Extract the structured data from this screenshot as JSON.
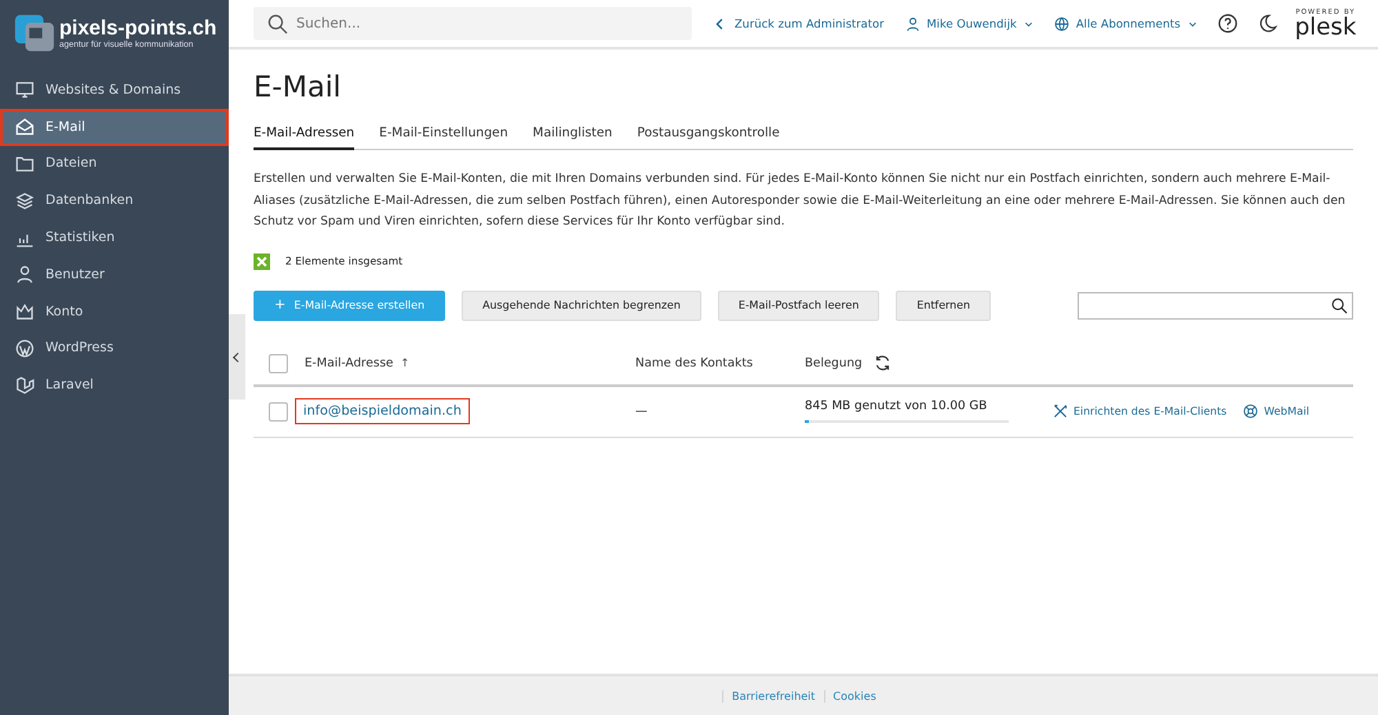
{
  "brand": {
    "name": "pixels-points.ch",
    "tagline": "agentur für visuelle kommunikation"
  },
  "sidebar": {
    "items": [
      {
        "label": "Websites & Domains",
        "selected": false,
        "highlighted": false
      },
      {
        "label": "E-Mail",
        "selected": true,
        "highlighted": true
      },
      {
        "label": "Dateien",
        "selected": false,
        "highlighted": false
      },
      {
        "label": "Datenbanken",
        "selected": false,
        "highlighted": false
      },
      {
        "label": "Statistiken",
        "selected": false,
        "highlighted": false
      },
      {
        "label": "Benutzer",
        "selected": false,
        "highlighted": false
      },
      {
        "label": "Konto",
        "selected": false,
        "highlighted": false
      },
      {
        "label": "WordPress",
        "selected": false,
        "highlighted": false
      },
      {
        "label": "Laravel",
        "selected": false,
        "highlighted": false
      }
    ]
  },
  "header": {
    "search": {
      "placeholder": "Suchen..."
    },
    "back_link": "Zurück zum Administrator",
    "user": "Mike Ouwendijk",
    "subscriptions": "Alle Abonnements",
    "powered_by": "POWERED BY",
    "plesk": "plesk"
  },
  "page": {
    "title": "E-Mail",
    "tabs": [
      {
        "label": "E-Mail-Adressen",
        "selected": true
      },
      {
        "label": "E-Mail-Einstellungen",
        "selected": false
      },
      {
        "label": "Mailinglisten",
        "selected": false
      },
      {
        "label": "Postausgangskontrolle",
        "selected": false
      }
    ],
    "description": "Erstellen und verwalten Sie E-Mail-Konten, die mit Ihren Domains verbunden sind. Für jedes E-Mail-Konto können Sie nicht nur ein Postfach einrichten, sondern auch mehrere E-Mail-Aliases (zusätzliche E-Mail-Adressen, die zum selben Postfach führen), einen Autoresponder sowie die E-Mail-Weiterleitung an eine oder mehrere E-Mail-Adressen. Sie können auch den Schutz vor Spam und Viren einrichten, sofern diese Services für Ihr Konto verfügbar sind.",
    "total": "2 Elemente insgesamt",
    "buttons": [
      {
        "label": "E-Mail-Adresse erstellen",
        "kind": "primary",
        "icon": "+"
      },
      {
        "label": "Ausgehende Nachrichten begrenzen",
        "kind": "secondary"
      },
      {
        "label": "E-Mail-Postfach leeren",
        "kind": "secondary"
      },
      {
        "label": "Entfernen",
        "kind": "secondary"
      }
    ],
    "table": {
      "select_all_checked": false,
      "columns": [
        "E-Mail-Adresse",
        "Name des Kontakts",
        "Belegung"
      ],
      "sort_mark": "↑",
      "rows": [
        {
          "checked": false,
          "address": "info@beispieldomain.ch",
          "highlighted": true,
          "contact": "—",
          "usage": "845 MB genutzt von 10.00 GB",
          "level": 0.02,
          "actions": [
            "Einrichten des E-Mail-Clients",
            "WebMail"
          ]
        }
      ]
    }
  },
  "footer": {
    "links": [
      "Barrierefreiheit",
      "Cookies"
    ]
  }
}
